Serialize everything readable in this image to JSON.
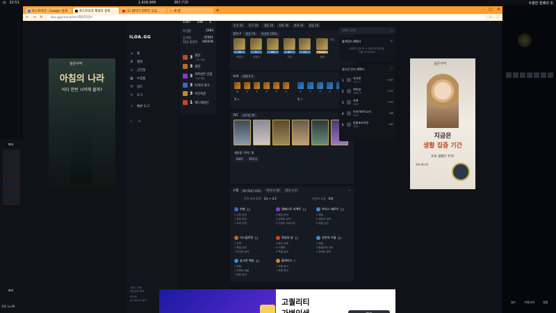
{
  "os": {
    "clock": "22:51",
    "stats": "1,618,949",
    "center_stat": "367,715",
    "right_title": "수분한 원배의 조"
  },
  "browser": {
    "tabs": [
      {
        "label": "로스트아크 - Google 검색",
        "active": false
      },
      {
        "label": "로스트아크 캐릭터 검색",
        "active": true
      },
      {
        "label": "(1) 랩이가 리퍼가 궁금...",
        "active": false
      },
      {
        "label": "새 탭",
        "active": false
      }
    ],
    "url": "iloa.gg/character/캐릭터정보"
  },
  "nav": {
    "logo": "ILOA.GG",
    "items": [
      {
        "label": "홈",
        "icon": "home-icon"
      },
      {
        "label": "랭킹",
        "icon": "trophy-icon"
      },
      {
        "label": "군단장",
        "icon": "sword-icon"
      },
      {
        "label": "수집품",
        "icon": "collection-icon"
      },
      {
        "label": "길드",
        "icon": "shield-icon"
      },
      {
        "label": "도구",
        "icon": "tool-icon"
      },
      {
        "label": "빠른 도구",
        "icon": "lightning-icon"
      }
    ],
    "footer": [
      "서비스 약관",
      "개인정보 정책",
      "피드백",
      "로스트아크 공식"
    ]
  },
  "character": {
    "top_vals": [
      "1567",
      "549",
      "1"
    ],
    "stats": [
      {
        "label": "특성합",
        "value": "2283"
      },
      {
        "label": "공격력",
        "value": "47001"
      },
      {
        "label": "최대 생명력",
        "value": "162036"
      }
    ],
    "engravings": [
      {
        "level": "3",
        "name": "원한",
        "sub": "+16 레벨",
        "color": "#c8461e"
      },
      {
        "level": "3",
        "name": "원한",
        "sub": "",
        "color": "#c86a1e"
      },
      {
        "level": "3",
        "name": "저주받은 인형",
        "sub": "+16 레벨",
        "color": "#8a3ac8"
      },
      {
        "level": "3",
        "name": "타격의 대가",
        "sub": "",
        "color": "#3a6ac8"
      },
      {
        "level": "3",
        "name": "속전속결",
        "sub": "",
        "color": "#c88a1e"
      },
      {
        "level": "1",
        "name": "에드레날린",
        "sub": "",
        "color": "#c8461e"
      }
    ]
  },
  "main": {
    "chips": [
      "투기 16",
      "투구 16",
      "견갑 16",
      "상의 16",
      "하의 16",
      "장갑 16"
    ],
    "equipment": {
      "title": "장신구",
      "pills": [
        "품질 78",
        "특성합 1902"
      ],
      "slots": [
        {
          "bar": "78",
          "label": "목걸이",
          "bar_color": "#3a8ad0"
        },
        {
          "bar": "72",
          "label": "귀걸이",
          "bar_color": "#3a8ad0"
        },
        {
          "bar": "88",
          "label": "",
          "bar_color": "#3a8ad0"
        },
        {
          "bar": "67",
          "label": "반지",
          "bar_color": "#3a8ad0"
        },
        {
          "bar": "72",
          "label": "",
          "bar_color": "#3a8ad0"
        },
        {
          "bar": "5.2%",
          "label": "팔찌",
          "bar_color": "#c8a04a"
        },
        {
          "bar": "7.9.4",
          "label": "어빌리티",
          "bar_color": "#c83aa0"
        }
      ],
      "extra": "특성"
    },
    "gems": {
      "title": "보석",
      "pill": "레벨 9.1",
      "levels": [
        "9",
        "7",
        "7",
        "7",
        "7",
        "7",
        "7",
        "7",
        "7",
        "7",
        "7"
      ],
      "groups": [
        "멸 6",
        "홍 5"
      ]
    },
    "cards": {
      "title": "카드",
      "pill": "세구빛 30",
      "set_title": "세상을 구하는 빛",
      "set_pills": [
        "6세트",
        "30각성"
      ]
    },
    "skills": {
      "title": "스킬",
      "pills": [
        "SP 416 / 420",
        "트라 × 16",
        "룬스 × 2"
      ],
      "summary": [
        {
          "label": "무력 파괴 합계",
          "value": "무x + 4.2"
        },
        {
          "label": "카운터 스킬",
          "value": "0개"
        }
      ],
      "list": [
        {
          "name": "천벌",
          "level": "12",
          "rows": [
            "1 심판 공격",
            "1 빛의 파장",
            "1 자비 공격"
          ],
          "color": "#3a6ac8"
        },
        {
          "name": "템페스트 리액트",
          "level": "12",
          "rows": [
            "5 빠른 준비",
            "5 강화된 일격",
            "5 인생의 크리스탈"
          ],
          "color": "#8a3ac8"
        },
        {
          "name": "아이스 애로우",
          "level": "12",
          "rows": [
            "5 해일",
            "5 해빙의 일격",
            "5 얼음 송곳"
          ],
          "color": "#3a8ad0"
        },
        {
          "name": "익스플로전",
          "level": "12",
          "rows": [
            "1 전파",
            "1 폭발 효과",
            "1 파괴의 일격"
          ],
          "color": "#c86a1e"
        },
        {
          "name": "화염의 날",
          "level": "12",
          "rows": [
            "4 화신 강화",
            "4 스펠바",
            "4 폭발 효과"
          ],
          "color": "#c8461e"
        },
        {
          "name": "푸른의 우물",
          "level": "10",
          "rows": [
            "5 해일",
            "4 물결반의 자비",
            "5 강화된 일격"
          ],
          "color": "#3a8ad0"
        },
        {
          "name": "숲고한 해일",
          "level": "10",
          "rows": [
            "1 해일",
            "1 진화된 해일",
            "1 해빙 일격"
          ],
          "color": "#3a8ad0"
        },
        {
          "name": "블레이즈",
          "level": "7",
          "rows": [
            "1 피해 증가",
            "1 화염 확산"
          ],
          "color": "#c88a1e"
        }
      ]
    }
  },
  "right": {
    "search_placeholder": "캐릭터 검색",
    "favorites_title": "즐겨찾기 캐릭터",
    "favorites_empty": "캐릭터 검색 후 ★ 버튼으로 즐겨찾기를 추가하세요",
    "ranking_title": "실시간 인기 캐릭터",
    "ranking": [
      {
        "rank": "1",
        "name": "유서현",
        "sub": "1672.5",
        "delta": "+187"
      },
      {
        "rank": "2",
        "name": "백지영",
        "sub": "1663.33",
        "delta": "+121"
      },
      {
        "rank": "3",
        "name": "쏘멘",
        "sub": "1660",
        "delta": "+101"
      },
      {
        "rank": "4",
        "name": "아리아카트쇼러",
        "sub": "1620",
        "delta": "+89"
      },
      {
        "rank": "5",
        "name": "방물포라이면",
        "sub": "1600",
        "delta": "+87"
      }
    ]
  },
  "ads": {
    "left": {
      "brand": "검은사막",
      "headline": "아침의 나라",
      "sub": "어디 한번 시작해 볼까?"
    },
    "right": {
      "brand": "검은사막",
      "headline_top": "지금은",
      "headline": "생활 집중 기간",
      "sub": "프로 생활러 주목!",
      "badge": "2배 패키지"
    },
    "bottom": {
      "headline1": "고퀄리티",
      "headline2": "가변인쇄",
      "button": "열기"
    }
  },
  "game": {
    "left_labels": [
      "파티",
      "파티",
      "전투 Lv.46"
    ],
    "right_labels": [
      "길드",
      "커뮤니티",
      "설정"
    ]
  }
}
